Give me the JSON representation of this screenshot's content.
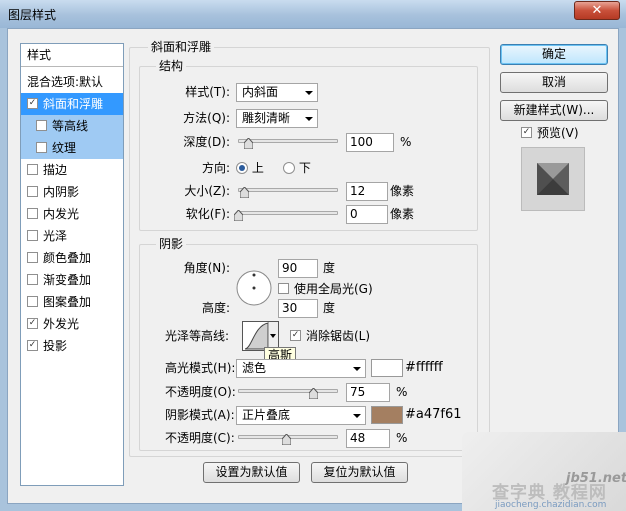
{
  "window": {
    "title": "图层样式",
    "close_glyph": "✕"
  },
  "sidebar": {
    "header": "样式",
    "items": [
      {
        "label": "混合选项:默认",
        "checked": null
      },
      {
        "label": "斜面和浮雕",
        "checked": true
      },
      {
        "label": "等高线",
        "checked": false
      },
      {
        "label": "纹理",
        "checked": false
      },
      {
        "label": "描边",
        "checked": false
      },
      {
        "label": "内阴影",
        "checked": false
      },
      {
        "label": "内发光",
        "checked": false
      },
      {
        "label": "光泽",
        "checked": false
      },
      {
        "label": "颜色叠加",
        "checked": false
      },
      {
        "label": "渐变叠加",
        "checked": false
      },
      {
        "label": "图案叠加",
        "checked": false
      },
      {
        "label": "外发光",
        "checked": true
      },
      {
        "label": "投影",
        "checked": true
      }
    ]
  },
  "bevel": {
    "title": "斜面和浮雕",
    "structure_title": "结构",
    "style_label": "样式(T):",
    "style_value": "内斜面",
    "technique_label": "方法(Q):",
    "technique_value": "雕刻清晰",
    "depth_label": "深度(D):",
    "depth_value": "100",
    "depth_unit": "%",
    "direction_label": "方向:",
    "dir_up": "上",
    "dir_down": "下",
    "size_label": "大小(Z):",
    "size_value": "12",
    "size_unit": "像素",
    "soften_label": "软化(F):",
    "soften_value": "0",
    "soften_unit": "像素"
  },
  "shading": {
    "title": "阴影",
    "angle_label": "角度(N):",
    "angle_value": "90",
    "angle_unit": "度",
    "global_light_label": "使用全局光(G)",
    "altitude_label": "高度:",
    "altitude_value": "30",
    "altitude_unit": "度",
    "gloss_label": "光泽等高线:",
    "antialias_label": "消除锯齿(L)",
    "tooltip": "高斯",
    "highlight_mode_label": "高光模式(H):",
    "highlight_mode_value": "滤色",
    "highlight_color": "#ffffff",
    "highlight_hex_text": "#ffffff",
    "highlight_opacity_label": "不透明度(O):",
    "highlight_opacity_value": "75",
    "highlight_opacity_unit": "%",
    "shadow_mode_label": "阴影模式(A):",
    "shadow_mode_value": "正片叠底",
    "shadow_color": "#a47f61",
    "shadow_hex_text": "#a47f61",
    "shadow_opacity_label": "不透明度(C):",
    "shadow_opacity_value": "48",
    "shadow_opacity_unit": "%"
  },
  "footer": {
    "make_default": "设置为默认值",
    "reset_default": "复位为默认值"
  },
  "actions": {
    "ok": "确定",
    "cancel": "取消",
    "new_style": "新建样式(W)...",
    "preview_label": "预览(V)"
  },
  "watermark": {
    "line1": "jb51.net",
    "line2": "查字典 教程网",
    "line3": "jiaocheng.chazidian.com"
  },
  "sliders": {
    "depth": 0.1,
    "size": 0.06,
    "soften": 0.0,
    "highlight_opacity": 0.75,
    "shadow_opacity": 0.48
  }
}
